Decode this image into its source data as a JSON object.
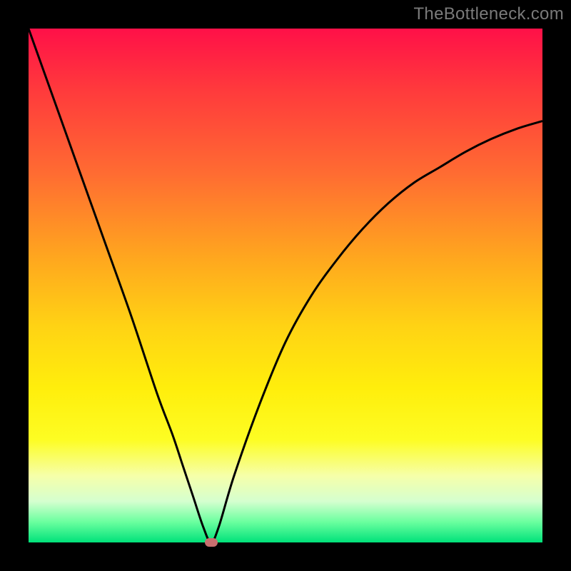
{
  "watermark": "TheBottleneck.com",
  "colors": {
    "frame": "#000000",
    "curve": "#000000",
    "marker": "#c86f6f"
  },
  "chart_data": {
    "type": "line",
    "title": "",
    "xlabel": "",
    "ylabel": "",
    "xlim": [
      0,
      100
    ],
    "ylim": [
      0,
      100
    ],
    "grid": false,
    "legend": false,
    "series": [
      {
        "name": "bottleneck-curve",
        "x": [
          0,
          5,
          10,
          15,
          20,
          25,
          28,
          30,
          32,
          34,
          35.5,
          37,
          40,
          45,
          50,
          55,
          60,
          65,
          70,
          75,
          80,
          85,
          90,
          95,
          100
        ],
        "y": [
          100,
          86,
          72,
          58,
          44,
          29,
          21,
          15,
          9,
          3,
          0,
          3,
          13,
          27,
          39,
          48,
          55,
          61,
          66,
          70,
          73,
          76,
          78.5,
          80.5,
          82
        ]
      }
    ],
    "marker": {
      "x": 35.5,
      "y": 0,
      "label": "optimal-point"
    },
    "background_gradient": {
      "top": "#ff1048",
      "mid": "#ffee0c",
      "bottom": "#00e27a",
      "meaning": "red=high bottleneck, green=low bottleneck"
    }
  }
}
